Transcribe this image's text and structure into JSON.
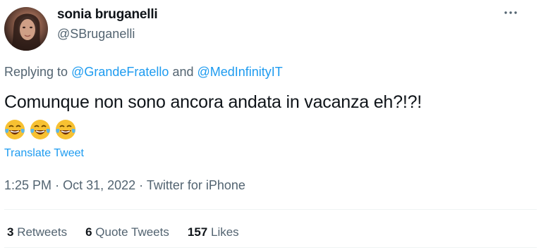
{
  "author": {
    "display_name": "sonia bruganelli",
    "handle": "@SBruganelli"
  },
  "more_icon": "more-horizontal-icon",
  "reply": {
    "prefix": "Replying to",
    "user1": "@GrandeFratello",
    "conjunction": "and",
    "user2": "@MedInfinityIT"
  },
  "tweet": {
    "text": "Comunque non sono ancora andata in vacanza eh?!?!",
    "emojis": [
      "face-with-tears-of-joy-icon",
      "face-with-tears-of-joy-icon",
      "face-with-tears-of-joy-icon"
    ],
    "translate_label": "Translate Tweet"
  },
  "meta": {
    "time": "1:25 PM",
    "separator": "·",
    "date": "Oct 31, 2022",
    "source": "Twitter for iPhone"
  },
  "stats": {
    "retweets_count": "3",
    "retweets_label": "Retweets",
    "quotes_count": "6",
    "quotes_label": "Quote Tweets",
    "likes_count": "157",
    "likes_label": "Likes"
  },
  "colors": {
    "link": "#1d9bf0",
    "secondary_text": "#536471",
    "primary_text": "#0f1419"
  }
}
